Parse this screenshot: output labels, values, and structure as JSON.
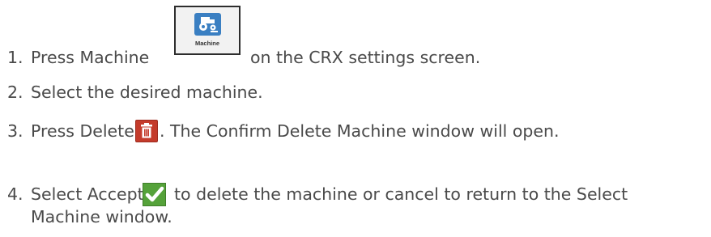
{
  "steps": [
    {
      "number": "1.",
      "before": "Press Machine",
      "after": "on the CRX settings screen."
    },
    {
      "number": "2.",
      "text": "Select the desired machine."
    },
    {
      "number": "3.",
      "before": "Press Delete",
      "after": ". The Confirm Delete Machine window will open."
    },
    {
      "number": "4.",
      "before": "Select Accept",
      "after": "to delete the machine or cancel to return to the Select",
      "continuation": "Machine window."
    }
  ],
  "icons": {
    "machine": {
      "name": "machine-icon",
      "caption": "Machine",
      "accent": "#3a7fc2"
    },
    "delete": {
      "name": "trash-icon",
      "color": "#c43b2b"
    },
    "accept": {
      "name": "checkmark-icon",
      "color": "#55a23a"
    }
  },
  "colors": {
    "text": "#4a4a4a"
  }
}
